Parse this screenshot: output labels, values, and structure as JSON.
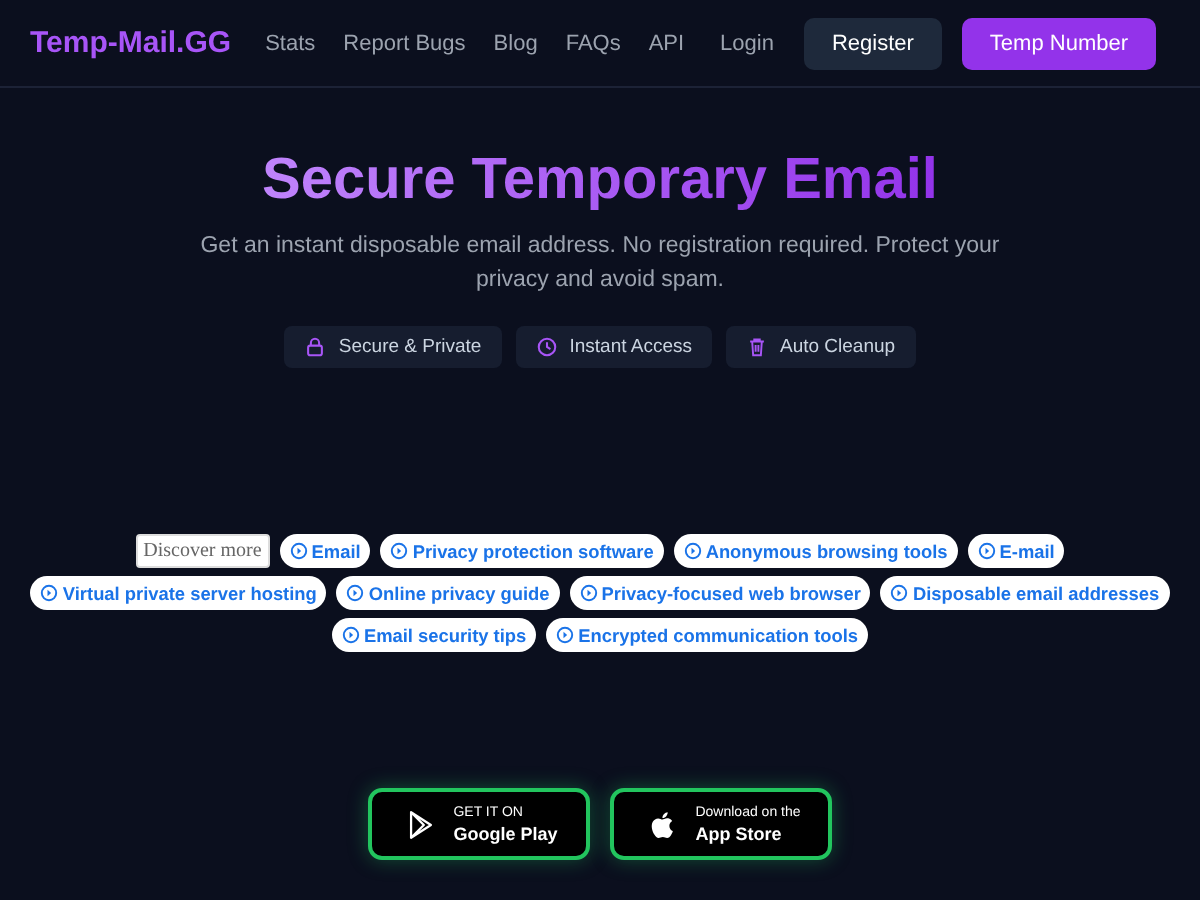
{
  "header": {
    "logo": "Temp-Mail.GG",
    "nav": [
      "Stats",
      "Report Bugs",
      "Blog",
      "FAQs",
      "API"
    ],
    "login": "Login",
    "register": "Register",
    "cta": "Temp Number"
  },
  "hero": {
    "title": "Secure Temporary Email",
    "subtitle": "Get an instant disposable email address. No registration required. Protect your privacy and avoid spam.",
    "features": [
      {
        "kind": "lock",
        "label": "Secure & Private"
      },
      {
        "kind": "clock",
        "label": "Instant Access"
      },
      {
        "kind": "trash",
        "label": "Auto Cleanup"
      }
    ]
  },
  "discover": {
    "label": "Discover more",
    "tags": [
      "Email",
      "Privacy protection software",
      "Anonymous browsing tools",
      "E-mail",
      "Virtual private server hosting",
      "Online privacy guide",
      "Privacy-focused web browser",
      "Disposable email addresses",
      "Email security tips",
      "Encrypted communication tools"
    ]
  },
  "stores": [
    {
      "kind": "google",
      "small": "GET IT ON",
      "big": "Google Play"
    },
    {
      "kind": "apple",
      "small": "Download on the",
      "big": "App Store"
    }
  ]
}
